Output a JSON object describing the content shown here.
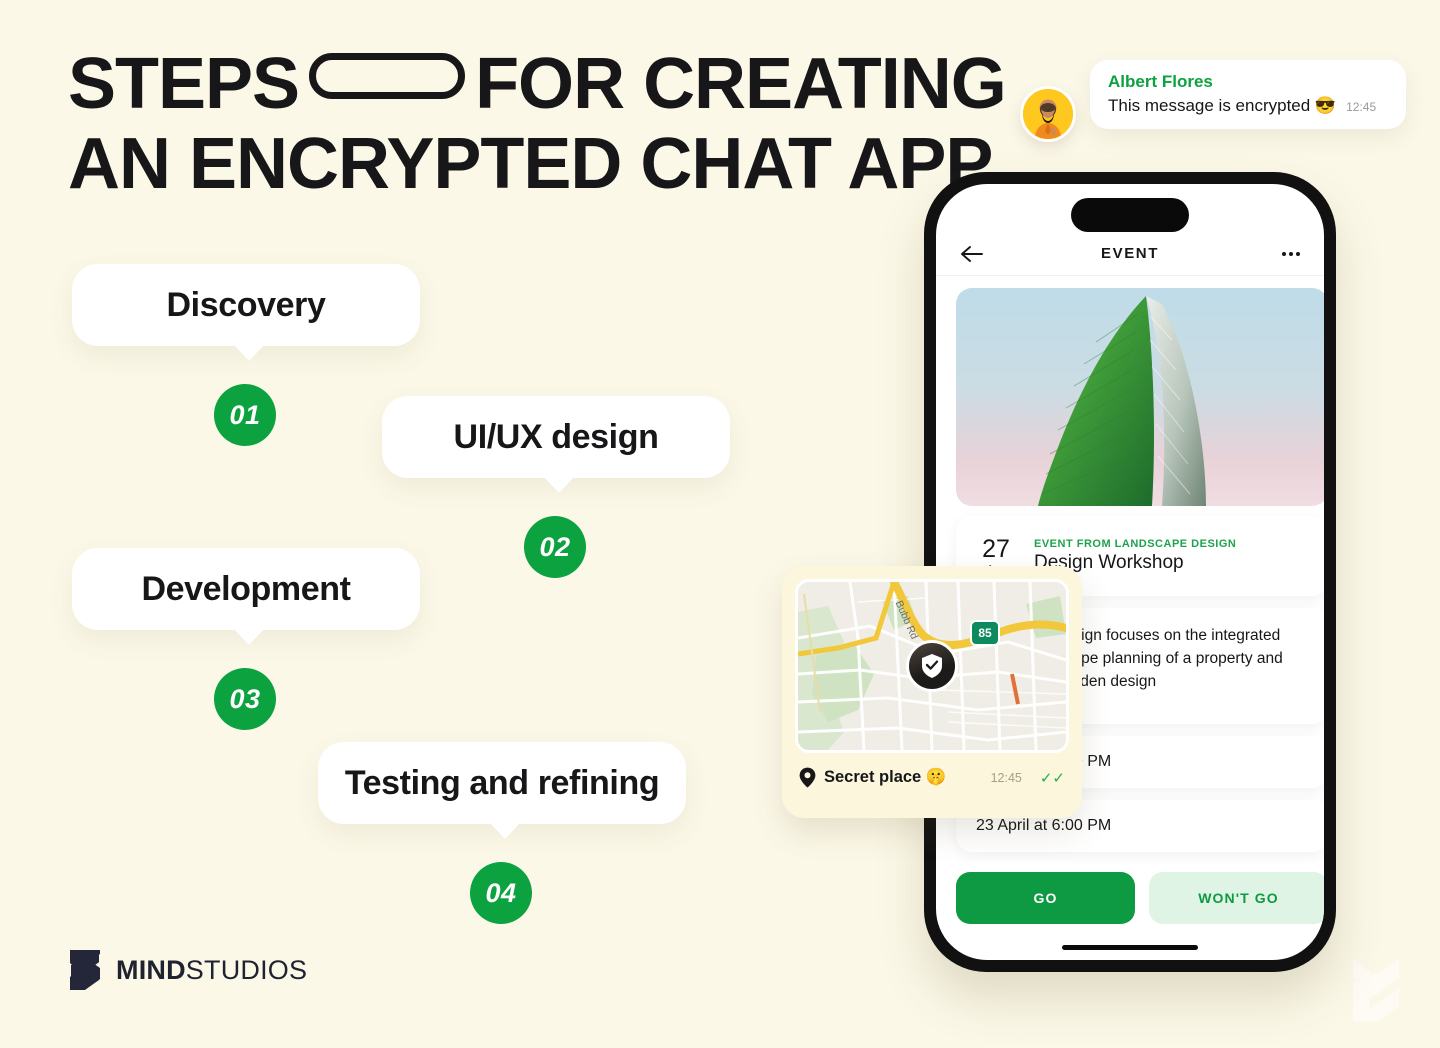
{
  "headline": {
    "line1_before": "STEPS",
    "line1_after": "FOR CREATING",
    "line2": "AN ENCRYPTED CHAT APP"
  },
  "steps": [
    {
      "label": "Discovery",
      "number": "01"
    },
    {
      "label": "UI/UX design",
      "number": "02"
    },
    {
      "label": "Development",
      "number": "03"
    },
    {
      "label": "Testing and refining",
      "number": "04"
    }
  ],
  "logo": {
    "bold": "MIND",
    "regular": "STUDIOS"
  },
  "chat_message": {
    "sender": "Albert Flores",
    "text": "This message is encrypted 😎",
    "time": "12:45"
  },
  "map_message": {
    "place": "Secret place 🤫",
    "time": "12:45",
    "read_ticks": "✓✓",
    "road_label": "Bubb Rd",
    "highway_number": "85",
    "pin_icon": "shield-check-icon"
  },
  "phone": {
    "nav": {
      "back_icon": "back-arrow-icon",
      "title": "EVENT",
      "menu_icon": "more-options-icon"
    },
    "event": {
      "day": "27",
      "month": "Apr",
      "category": "EVENT FROM LANDSCAPE DESIGN",
      "title": "Design Workshop"
    },
    "description": "Landscape design focuses on the integrated master landscape planning of a property and the specific garden design",
    "times": [
      "27 April at 4:00 PM",
      "23 April at 6:00 PM"
    ],
    "buttons": {
      "go": "GO",
      "wont_go": "WON'T GO"
    }
  },
  "colors": {
    "background": "#FCF8E8",
    "green": "#0BA23F",
    "green_dark": "#0E9A42",
    "green_light": "#DFF4E4",
    "ink": "#17171A"
  }
}
